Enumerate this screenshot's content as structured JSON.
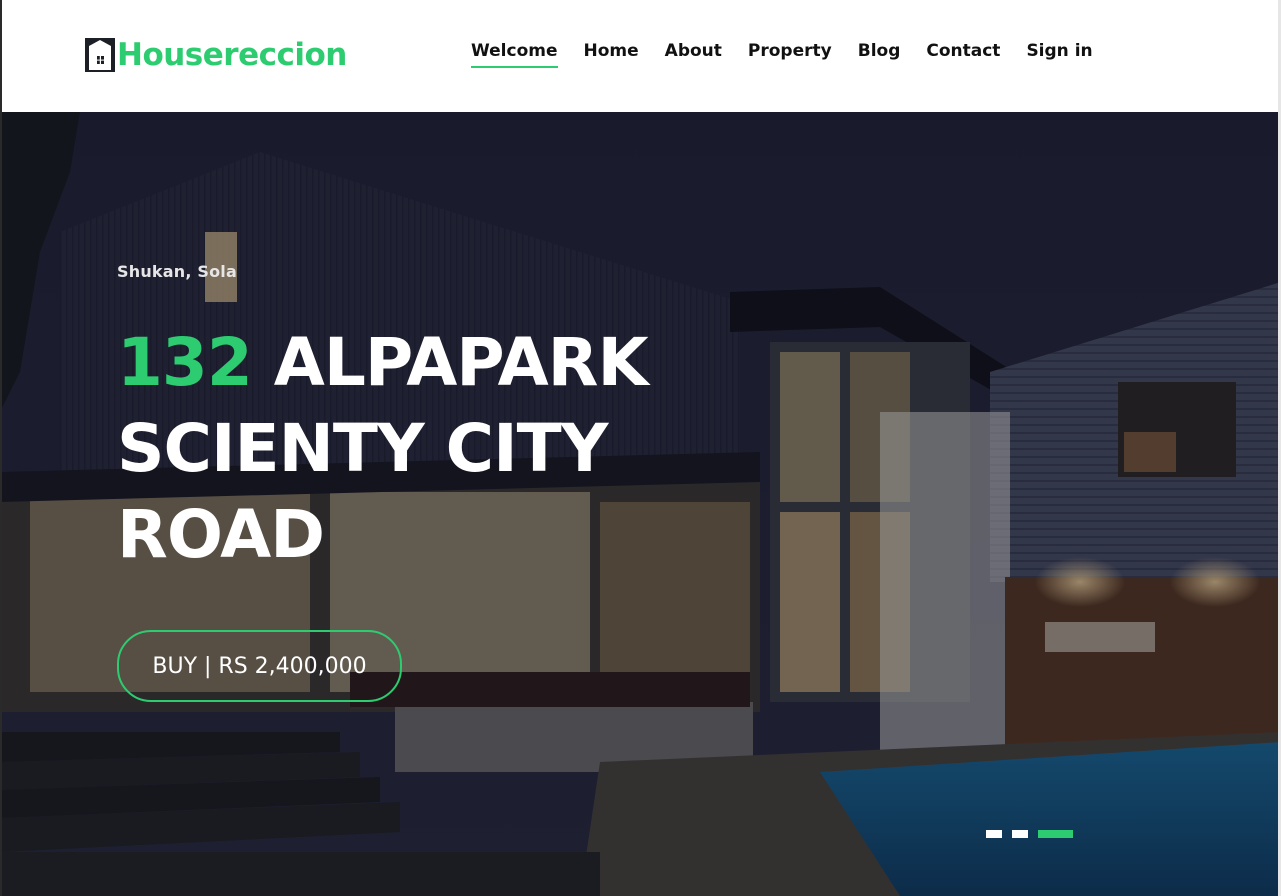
{
  "brand": {
    "name": "Housereccion",
    "icon": "house-logo-icon",
    "accent_color": "#2dcc70"
  },
  "nav": {
    "items": [
      {
        "label": "Welcome",
        "active": true
      },
      {
        "label": "Home"
      },
      {
        "label": "About"
      },
      {
        "label": "Property"
      },
      {
        "label": "Blog"
      },
      {
        "label": "Contact"
      },
      {
        "label": "Sign in"
      }
    ]
  },
  "hero": {
    "location": "Shukan, Sola",
    "headline_number": "132",
    "headline_text": "ALPAPARK SCIENTY CITY ROAD",
    "cta_label": "BUY | RS 2,400,000",
    "background": "modern house at night with pool",
    "slider": {
      "count": 3,
      "active_index": 3
    }
  },
  "colors": {
    "accent": "#2dcc70",
    "text": "#111111",
    "hero_text": "#ffffff"
  }
}
